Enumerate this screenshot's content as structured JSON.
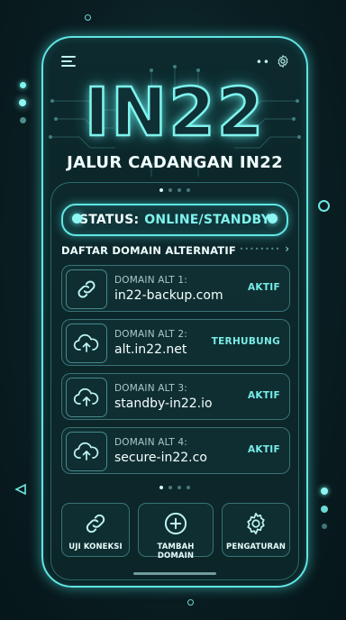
{
  "app": {
    "logo": "IN22",
    "subtitle": "JALUR CADANGAN IN22"
  },
  "status": {
    "label": "STATUS:",
    "value": "ONLINE/STANDBY"
  },
  "domain_list": {
    "title": "DAFTAR DOMAIN ALTERNATIF",
    "items": [
      {
        "label": "DOMAIN ALT 1:",
        "name": "in22-backup.com",
        "status": "AKTIF",
        "icon": "link-icon"
      },
      {
        "label": "DOMAIN ALT 2:",
        "name": "alt.in22.net",
        "status": "TERHUBUNG",
        "icon": "cloud-upload-icon"
      },
      {
        "label": "DOMAIN ALT 3:",
        "name": "standby-in22.io",
        "status": "AKTIF",
        "icon": "cloud-upload-icon"
      },
      {
        "label": "DOMAIN ALT 4:",
        "name": "secure-in22.co",
        "status": "AKTIF",
        "icon": "cloud-upload-icon"
      }
    ]
  },
  "actions": [
    {
      "label": "UJI KONEKSI",
      "icon": "link-icon"
    },
    {
      "label": "TAMBAH DOMAIN",
      "icon": "plus-circle-icon"
    },
    {
      "label": "PENGATURAN",
      "icon": "gear-icon"
    }
  ],
  "colors": {
    "accent": "#5fe6e3",
    "background": "#0a1e22",
    "status_text": "#77ece7"
  }
}
